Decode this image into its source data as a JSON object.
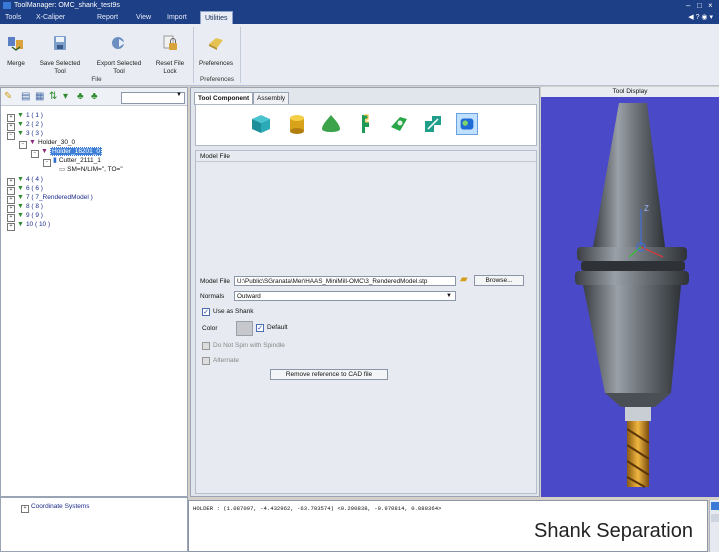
{
  "window": {
    "title": "ToolManager: OMC_shank_test9s",
    "controls": [
      "–",
      "□",
      "×"
    ]
  },
  "menu": {
    "items": [
      "Tools",
      "X-Caliper",
      "Report",
      "View",
      "Import",
      "Utilities"
    ],
    "right": "◀ ? ◉ ▾"
  },
  "ribbon": {
    "buttons": [
      "Merge",
      "Save Selected\nTool",
      "Export Selected\nTool",
      "Reset File\nLock",
      "Preferences"
    ],
    "groups": [
      "File",
      "Preferences"
    ]
  },
  "tree": {
    "toolbar_combo": "",
    "items": [
      "1 ( 1 )",
      "2 ( 2 )",
      "3 ( 3 )",
      "Holder_30_0",
      "Holder_16201_0",
      "Cutter_2111_1",
      "SM=N/LIM=\", TO=\"",
      "4 ( 4 )",
      "6 ( 6 )",
      "7 ( 7_RenderedModel )",
      "8 ( 8 )",
      "9 ( 9 )",
      "10 ( 10 )"
    ]
  },
  "coordinate": {
    "label": "Coordinate Systems"
  },
  "center": {
    "tabs": [
      "Tool Component",
      "Assembly"
    ],
    "group_title": "Model File",
    "model_file_label": "Model File",
    "model_file_value": "U:\\Public\\SGranata\\Mer\\HAAS_MiniMill-OMC\\3_RenderedModel.stp",
    "browse_label": "Browse...",
    "normals_label": "Normals",
    "normals_value": "Outward",
    "use_as_shank": "Use as Shank",
    "color_label": "Color",
    "default_label": "Default",
    "do_not_spin": "Do Not Spin with Spindle",
    "alternate": "Alternate",
    "remove_ref": "Remove reference to CAD file"
  },
  "console": {
    "text": "HOLDER : (1.087097, -4.432962, -63.703574)  <0.200838, -0.970814, 0.080364>"
  },
  "tool_display": {
    "title": "Tool Display",
    "axis_z": "Z"
  },
  "overlay": {
    "text": "Shank Separation"
  },
  "colors": {
    "titlebar": "#1d3f86",
    "viewport": "#4a49c7",
    "ribbon": "#e9edf3"
  },
  "icons": [
    "merge-icon",
    "save-tool-icon",
    "export-tool-icon",
    "reset-lock-icon",
    "preferences-icon"
  ]
}
